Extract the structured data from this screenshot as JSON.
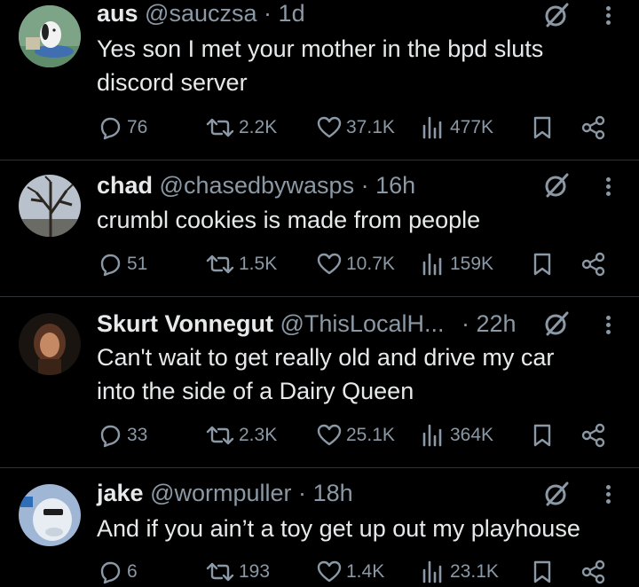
{
  "tweets": [
    {
      "name": "aus",
      "handle": "@sauczsa",
      "sep": "·",
      "time": "1d",
      "lines": [
        "Yes son I met your mother in the bpd sluts",
        "discord server"
      ],
      "replies": "76",
      "reposts": "2.2K",
      "likes": "37.1K",
      "views": "477K"
    },
    {
      "name": "chad",
      "handle": "@chasedbywasps",
      "sep": "·",
      "time": "16h",
      "lines": [
        "crumbl cookies is made from people"
      ],
      "replies": "51",
      "reposts": "1.5K",
      "likes": "10.7K",
      "views": "159K"
    },
    {
      "name": "Skurt Vonnegut",
      "handle": "@ThisLocalH...",
      "sep": "·",
      "time": "22h",
      "lines": [
        "Can't wait to get really old and drive my car",
        "into the side of a Dairy Queen"
      ],
      "replies": "33",
      "reposts": "2.3K",
      "likes": "25.1K",
      "views": "364K"
    },
    {
      "name": "jake",
      "handle": "@wormpuller",
      "sep": "·",
      "time": "18h",
      "lines": [
        "And if you ain’t a toy get up out my playhouse"
      ],
      "replies": "6",
      "reposts": "193",
      "likes": "1.4K",
      "views": "23.1K"
    }
  ],
  "colors": {
    "background": "#000000",
    "text": "#e7e9ea",
    "muted": "#8b98a5",
    "divider": "#2f3336"
  },
  "icons": [
    "reply-icon",
    "repost-icon",
    "like-icon",
    "views-icon",
    "bookmark-icon",
    "share-icon",
    "grok-icon",
    "more-icon"
  ]
}
